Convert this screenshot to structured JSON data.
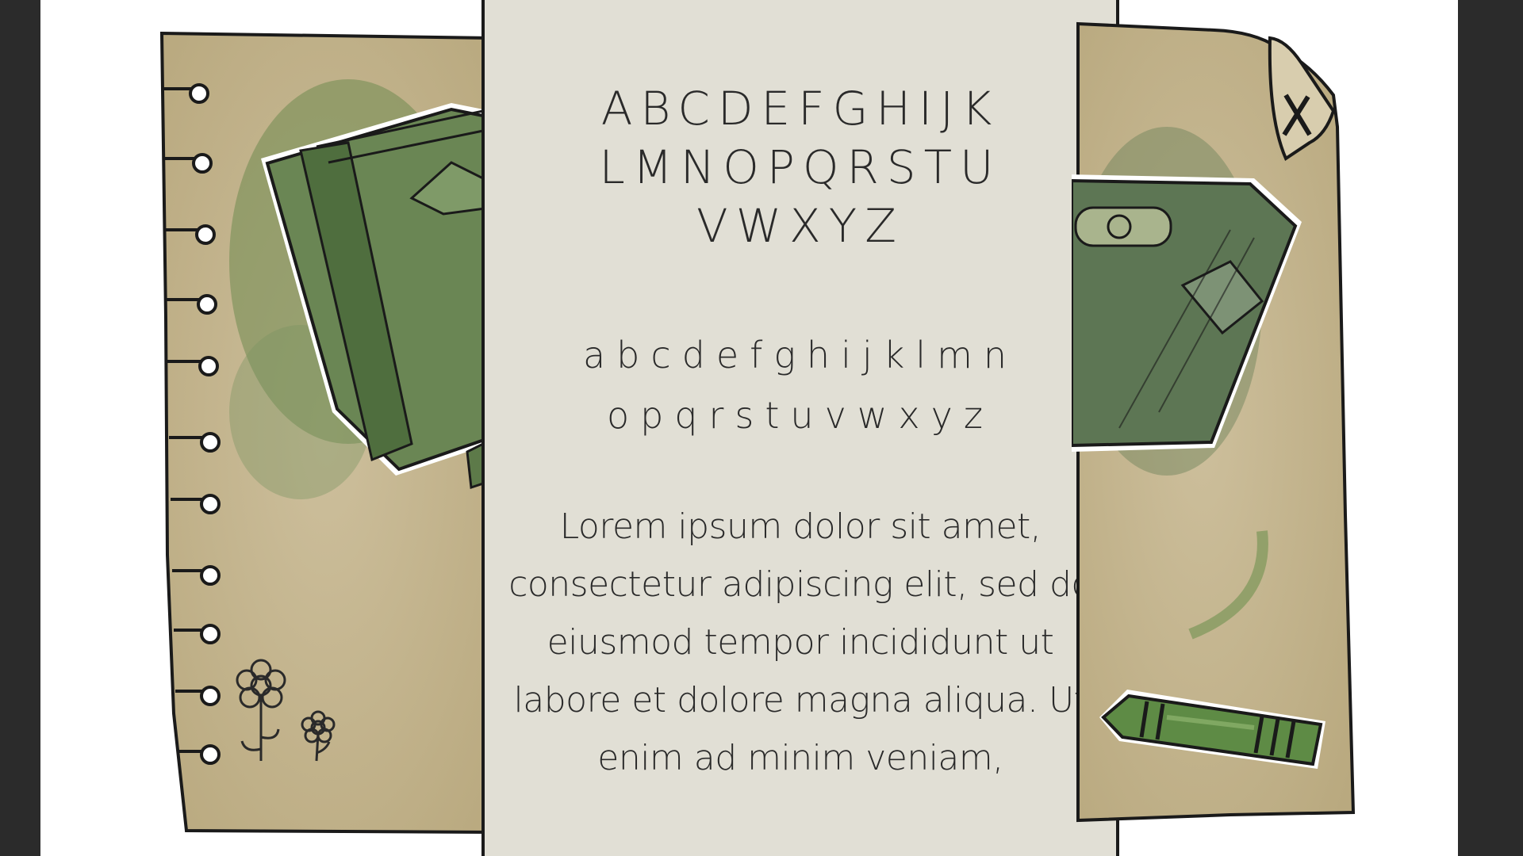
{
  "specimen": {
    "uppercase_lines": [
      "ABCDEFGHIJK",
      "LMNOPQRSTU",
      "VWXYZ"
    ],
    "lowercase_lines": [
      "abcdefghijklmn",
      "opqrstuvwxyz"
    ],
    "sample_text": "Lorem ipsum dolor sit amet, consectetur adipiscing elit, sed do eiusmod tempor incididunt ut labore et dolore magna aliqua. Ut enim ad minim veniam,"
  },
  "icons": {
    "left_panel": [
      "notebook-spiral-icon",
      "book-illustration-icon",
      "flowers-doodle-icon"
    ],
    "right_panel": [
      "close-icon",
      "book-illustration-icon",
      "crayon-icon"
    ]
  },
  "colors": {
    "page_bg": "#2b2b2b",
    "canvas": "#ffffff",
    "specimen_bg": "#e1dfd5",
    "paper": "#c9b994",
    "ink": "#1a1a1a",
    "wash_green": "#5c7a45"
  }
}
